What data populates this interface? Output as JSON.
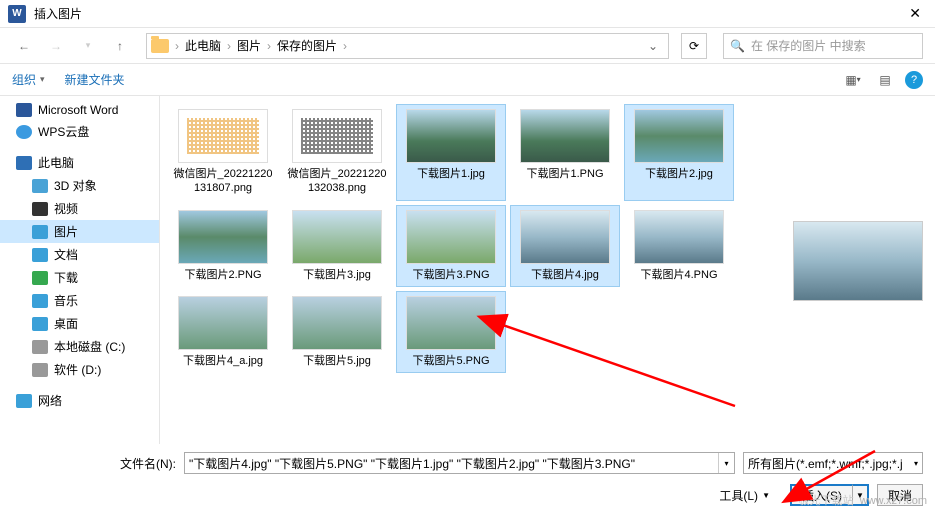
{
  "title": "插入图片",
  "breadcrumb": [
    "此电脑",
    "图片",
    "保存的图片"
  ],
  "search_placeholder": "在 保存的图片 中搜索",
  "toolbar": {
    "organize": "组织",
    "new_folder": "新建文件夹"
  },
  "sidebar": {
    "word": "Microsoft Word",
    "wps": "WPS云盘",
    "pc": "此电脑",
    "obj3d": "3D 对象",
    "video": "视频",
    "pictures": "图片",
    "docs": "文档",
    "downloads": "下载",
    "music": "音乐",
    "desktop": "桌面",
    "drive_c": "本地磁盘 (C:)",
    "drive_d": "软件 (D:)",
    "network": "网络"
  },
  "files": [
    {
      "name": "微信图片_2022122013​1807.png",
      "sel": false,
      "cls": "qr orange"
    },
    {
      "name": "微信图片_2022122013​2038.png",
      "sel": false,
      "cls": "qr"
    },
    {
      "name": "下载图片1.jpg",
      "sel": true,
      "cls": "t1"
    },
    {
      "name": "下载图片1.PNG",
      "sel": false,
      "cls": "t1"
    },
    {
      "name": "下载图片2.jpg",
      "sel": true,
      "cls": "t2"
    },
    {
      "name": "下载图片2.PNG",
      "sel": false,
      "cls": "t2"
    },
    {
      "name": "下载图片3.jpg",
      "sel": false,
      "cls": "t3"
    },
    {
      "name": "下载图片3.PNG",
      "sel": true,
      "cls": "t3"
    },
    {
      "name": "下载图片4.jpg",
      "sel": true,
      "cls": "t4"
    },
    {
      "name": "下载图片4.PNG",
      "sel": false,
      "cls": "t4"
    },
    {
      "name": "下载图片4_a.jpg",
      "sel": false,
      "cls": "t5"
    },
    {
      "name": "下载图片5.jpg",
      "sel": false,
      "cls": "t5"
    },
    {
      "name": "下载图片5.PNG",
      "sel": true,
      "cls": "t5"
    }
  ],
  "filename": {
    "label": "文件名(N):",
    "value": "\"下载图片4.jpg\" \"下载图片5.PNG\" \"下载图片1.jpg\" \"下载图片2.jpg\" \"下载图片3.PNG\""
  },
  "filter": "所有图片(*.emf;*.wmf;*.jpg;*.j",
  "tools_label": "工具(L)",
  "insert": "插入(S)",
  "cancel": "取消",
  "watermark": {
    "a": "极光下载站",
    "b": "www.xz7.com"
  }
}
